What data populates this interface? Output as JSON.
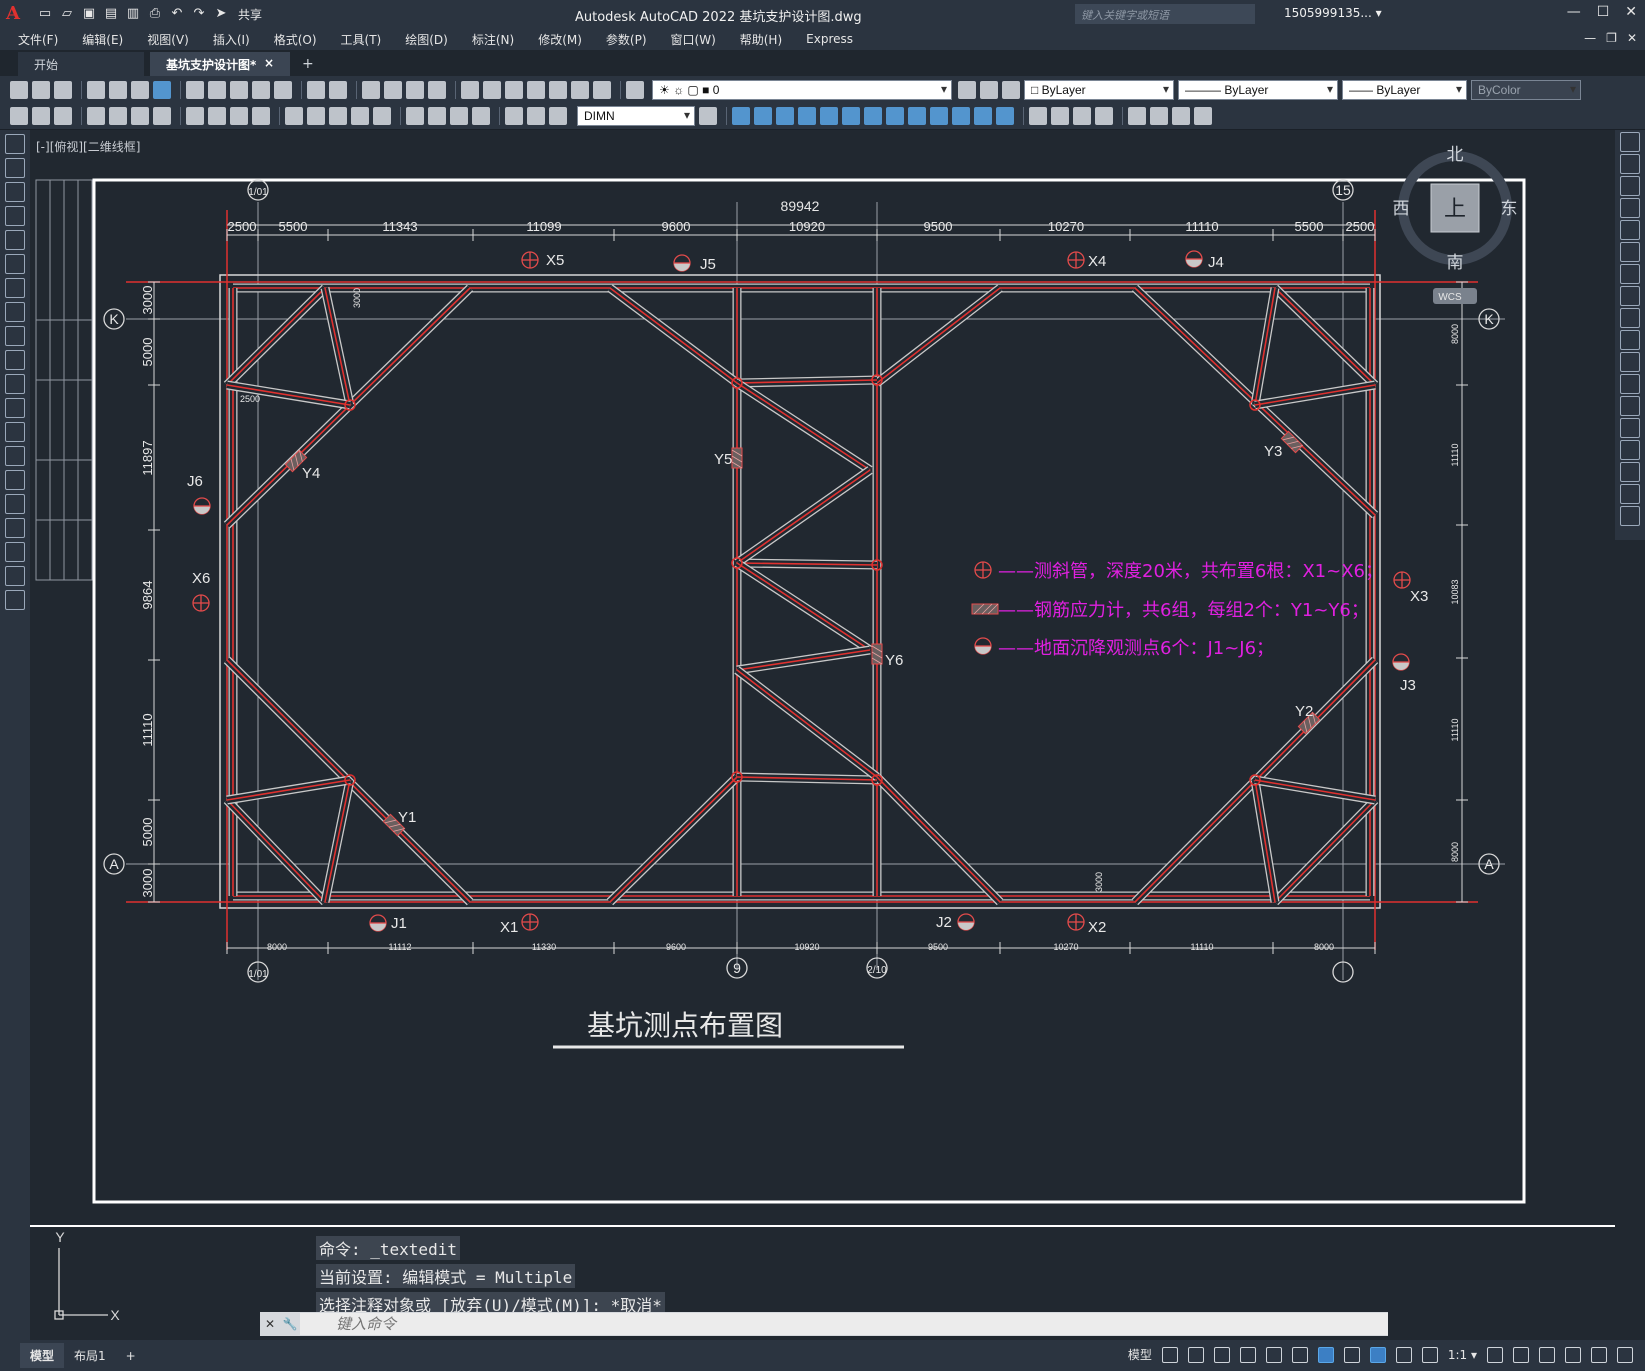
{
  "app": {
    "title": "Autodesk AutoCAD 2022    基坑支护设计图.dwg",
    "search_placeholder": "键入关键字或短语",
    "user": "1505999135... ▾",
    "share_label": "共享"
  },
  "menu": [
    "文件(F)",
    "编辑(E)",
    "视图(V)",
    "插入(I)",
    "格式(O)",
    "工具(T)",
    "绘图(D)",
    "标注(N)",
    "修改(M)",
    "参数(P)",
    "窗口(W)",
    "帮助(H)",
    "Express"
  ],
  "tabs": {
    "start": "开始",
    "drawing": "基坑支护设计图*",
    "close": "×",
    "new": "+"
  },
  "toolbar": {
    "layer": "0",
    "color": "ByLayer",
    "linetype": "ByLayer",
    "lineweight": "ByLayer",
    "plotstyle": "ByColor",
    "dimstyle": "DIMN"
  },
  "viewport": {
    "label": "[-][俯视][二维线框]"
  },
  "viewcube": {
    "north": "北",
    "south": "南",
    "east": "东",
    "west": "西",
    "face": "上",
    "wcs": "WCS"
  },
  "drawing": {
    "title": "基坑测点布置图",
    "overall_dim": "89942",
    "top_dims": [
      "2500",
      "5500",
      "11343",
      "11099",
      "9600",
      "10920",
      "9500",
      "10270",
      "11110",
      "5500",
      "2500"
    ],
    "bottom_dims": [
      "8000",
      "11112",
      "11330",
      "9600",
      "10920",
      "9500",
      "10270",
      "11110",
      "8000"
    ],
    "left_dims": [
      "3000",
      "5000",
      "11897",
      "9864",
      "11110",
      "5000",
      "3000"
    ],
    "right_dims": [
      "8000",
      "11110",
      "10083",
      "11110",
      "8000"
    ],
    "small_dims": [
      "3000",
      "2500",
      "3000"
    ],
    "grid_bubbles": [
      "1/01",
      "15",
      "K",
      "K",
      "A",
      "A",
      "1/01",
      "9",
      "2/10",
      ""
    ],
    "monitor_labels": {
      "X": [
        "X1",
        "X2",
        "X3",
        "X4",
        "X5",
        "X6"
      ],
      "J": [
        "J1",
        "J2",
        "J3",
        "J4",
        "J5",
        "J6"
      ],
      "Y": [
        "Y1",
        "Y2",
        "Y3",
        "Y4",
        "Y5",
        "Y6"
      ]
    },
    "legend": [
      "——测斜管，深度20米，共布置6根：X1~X6；",
      "——钢筋应力计，共6组，每组2个：Y1~Y6；",
      "——地面沉降观测点6个：J1~J6；"
    ],
    "ucs": {
      "y": "Y",
      "x": "X"
    }
  },
  "command": {
    "history": [
      "命令: _textedit",
      "当前设置: 编辑模式 = Multiple",
      "选择注释对象或 [放弃(U)/模式(M)]: *取消*"
    ],
    "placeholder": "键入命令"
  },
  "status": {
    "model_tab": "模型",
    "layout_tab": "布局1",
    "add": "+",
    "model": "模型",
    "scale": "1:1 ▾"
  },
  "colors": {
    "wall": "#e0312f",
    "strut": "#c8c8c8",
    "legend": "#e020e0",
    "background": "#212830",
    "ui": "#2b3440"
  }
}
